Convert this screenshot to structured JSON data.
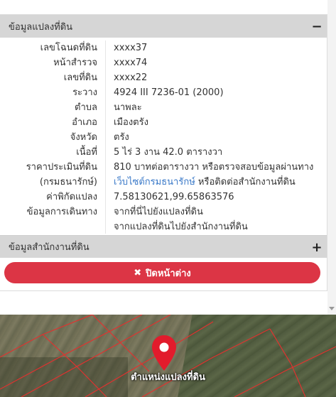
{
  "land_info": {
    "header": "ข้อมูลแปลงที่ดิน",
    "toggle": "−",
    "rows": [
      {
        "label": "เลขโฉนดที่ดิน",
        "value": "xxxx37"
      },
      {
        "label": "หน้าสำรวจ",
        "value": "xxxx74"
      },
      {
        "label": "เลขที่ดิน",
        "value": "xxxx22"
      },
      {
        "label": "ระวาง",
        "value": "4924 III 7236-01 (2000)"
      },
      {
        "label": "ตำบล",
        "value": "นาพละ"
      },
      {
        "label": "อำเภอ",
        "value": "เมืองตรัง"
      },
      {
        "label": "จังหวัด",
        "value": "ตรัง"
      },
      {
        "label": "เนื้อที่",
        "value": "5 ไร่ 3 งาน 42.0 ตารางวา"
      },
      {
        "label": "ราคาประเมินที่ดิน",
        "value": "810 บาทต่อตารางวา หรือตรวจสอบข้อมูลผ่านทาง"
      },
      {
        "label": "(กรมธนารักษ์)",
        "value_link": "เว็บไซต์กรมธนารักษ์",
        "value_rest": " หรือติดต่อสำนักงานที่ดิน"
      },
      {
        "label": "ค่าพิกัดแปลง",
        "value_link": "7.58130621,99.65863576"
      },
      {
        "label": "ข้อมูลการเดินทาง",
        "value_link": "จากที่นี่ไปยังแปลงที่ดิน"
      },
      {
        "label": "",
        "value_link": "จากแปลงที่ดินไปยังสำนักงานที่ดิน"
      }
    ]
  },
  "office_info": {
    "header": "ข้อมูลสำนักงานที่ดิน",
    "toggle": "+"
  },
  "close_button": {
    "label": "ปิดหน้าต่าง"
  },
  "map": {
    "label": "ตำแหน่งแปลงที่ดิน"
  },
  "colors": {
    "accent_red": "#dc3545",
    "link_blue": "#3a79c8",
    "header_gray": "#d6d6d6"
  }
}
